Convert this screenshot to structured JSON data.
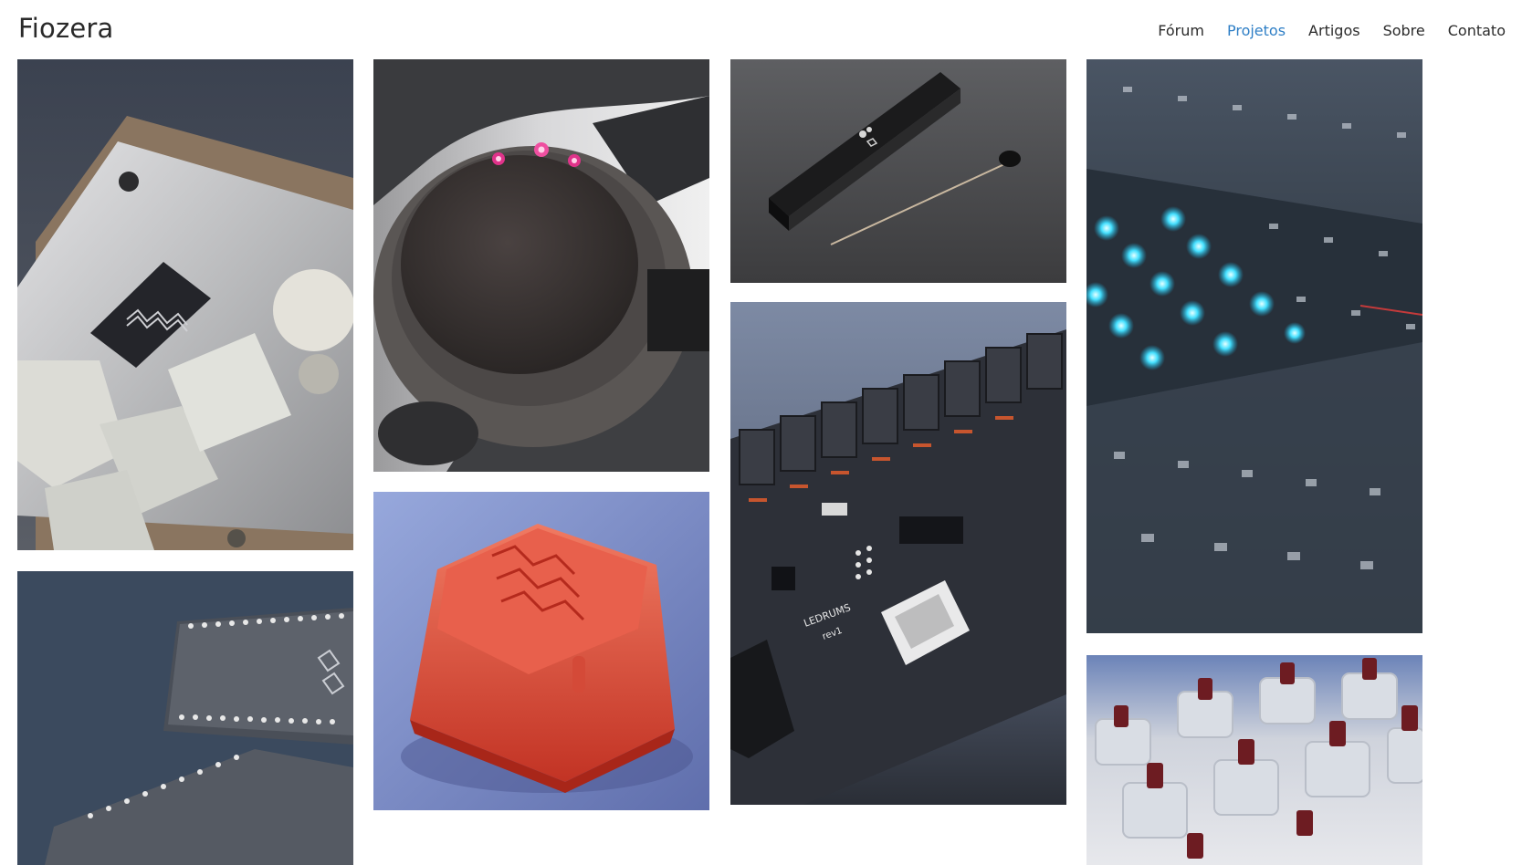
{
  "site": {
    "brand": "Fiozera"
  },
  "nav": {
    "items": [
      {
        "label": "Fórum",
        "active": false
      },
      {
        "label": "Projetos",
        "active": true
      },
      {
        "label": "Artigos",
        "active": false
      },
      {
        "label": "Sobre",
        "active": false
      },
      {
        "label": "Contato",
        "active": false
      }
    ],
    "active_color": "#2f7fc6"
  },
  "gallery": {
    "tiles": [
      {
        "subject": "macropad with oled display and white keycaps"
      },
      {
        "subject": "round handlebar device with three pink leds"
      },
      {
        "subject": "black stick controller with baton"
      },
      {
        "subject": "keyboard pcb with blue leds"
      },
      {
        "subject": "microcontroller boards on blue background"
      },
      {
        "subject": "red translucent keycap"
      },
      {
        "subject": "ledrums circuit board",
        "pcb_label": "LEDRUMS",
        "pcb_sublabel": "rev1"
      },
      {
        "subject": "mechanical switches with red stems"
      }
    ]
  }
}
